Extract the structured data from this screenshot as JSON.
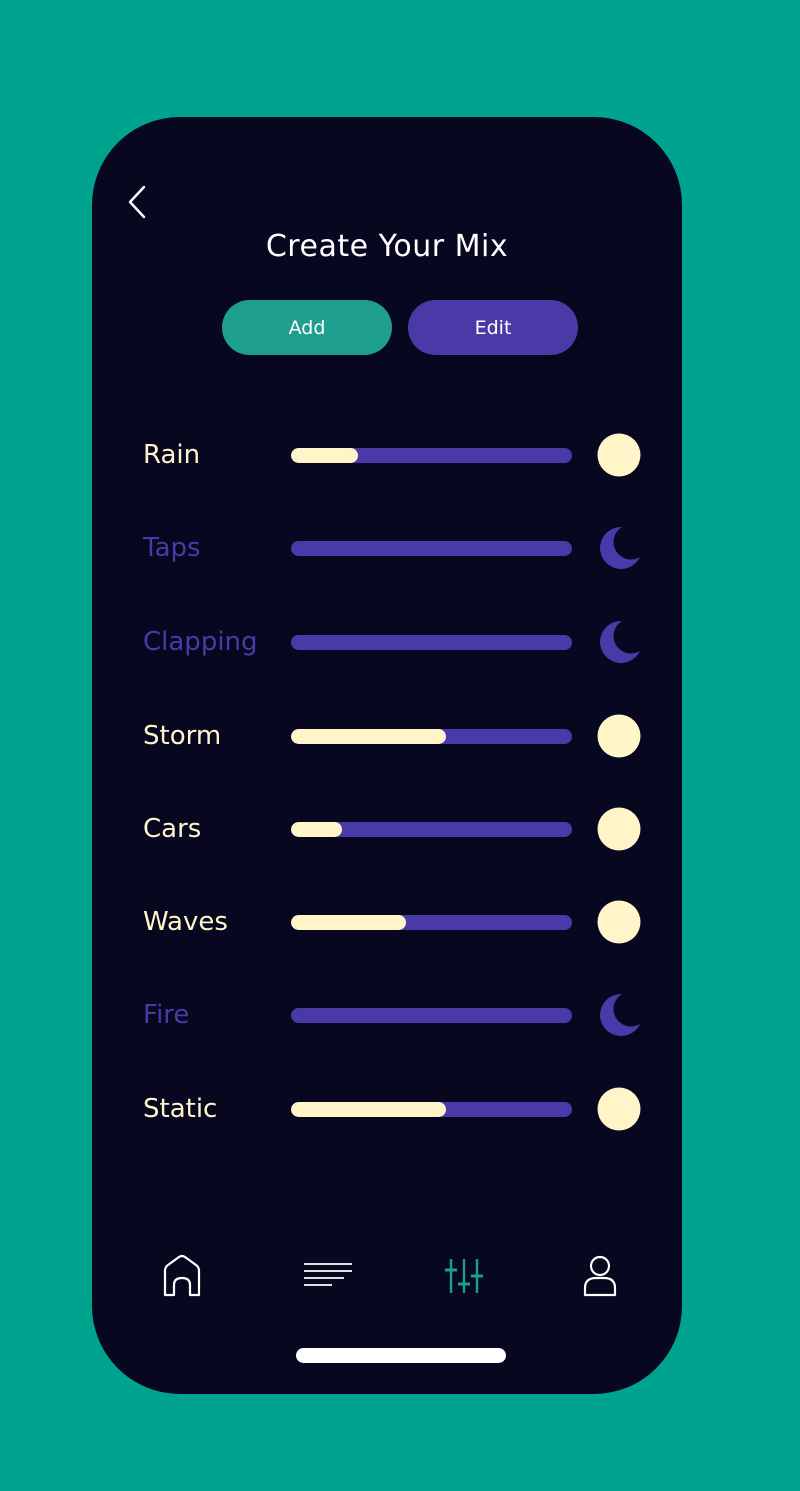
{
  "screen": {
    "title": "Create Your Mix"
  },
  "actions": {
    "add_label": "Add",
    "edit_label": "Edit"
  },
  "mix": [
    {
      "label": "Rain",
      "level": 0.24,
      "enabled": true,
      "toggle_icon": "sun-icon"
    },
    {
      "label": "Taps",
      "level": 0,
      "enabled": false,
      "toggle_icon": "moon-icon"
    },
    {
      "label": "Clapping",
      "level": 0,
      "enabled": false,
      "toggle_icon": "moon-icon"
    },
    {
      "label": "Storm",
      "level": 0.55,
      "enabled": true,
      "toggle_icon": "sun-icon"
    },
    {
      "label": "Cars",
      "level": 0.18,
      "enabled": true,
      "toggle_icon": "sun-icon"
    },
    {
      "label": "Waves",
      "level": 0.41,
      "enabled": true,
      "toggle_icon": "sun-icon"
    },
    {
      "label": "Fire",
      "level": 0,
      "enabled": false,
      "toggle_icon": "moon-icon"
    },
    {
      "label": "Static",
      "level": 0.55,
      "enabled": true,
      "toggle_icon": "sun-icon"
    }
  ],
  "tabbar": {
    "items": [
      {
        "icon": "home-icon",
        "active": false
      },
      {
        "icon": "list-icon",
        "active": false
      },
      {
        "icon": "sliders-icon",
        "active": true
      },
      {
        "icon": "profile-icon",
        "active": false
      }
    ]
  },
  "colors": {
    "background": "#00a38e",
    "screen": "#070720",
    "accent_teal": "#1e9e8c",
    "accent_purple": "#4a3aa8",
    "cream": "#fff5c8"
  }
}
